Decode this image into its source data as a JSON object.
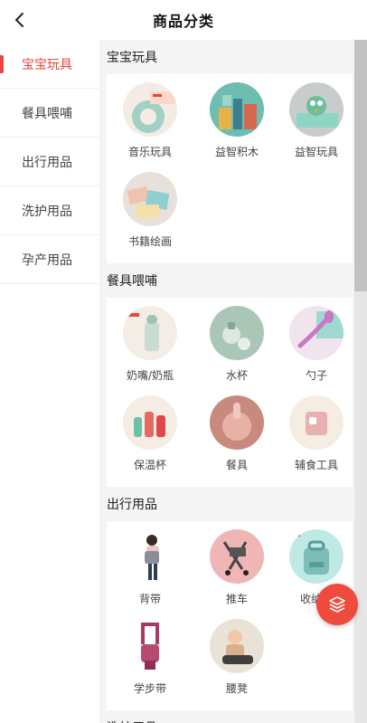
{
  "header": {
    "title": "商品分类",
    "back_icon": "chevron-left-icon"
  },
  "sidebar": {
    "active_index": 0,
    "items": [
      {
        "label": "宝宝玩具"
      },
      {
        "label": "餐具喂哺"
      },
      {
        "label": "出行用品"
      },
      {
        "label": "洗护用品"
      },
      {
        "label": "孕产用品"
      }
    ]
  },
  "sections": [
    {
      "title": "宝宝玩具",
      "items": [
        {
          "label": "音乐玩具"
        },
        {
          "label": "益智积木"
        },
        {
          "label": "益智玩具"
        },
        {
          "label": "书籍绘画"
        }
      ]
    },
    {
      "title": "餐具喂哺",
      "items": [
        {
          "label": "奶嘴/奶瓶"
        },
        {
          "label": "水杯"
        },
        {
          "label": "勺子"
        },
        {
          "label": "保温杯"
        },
        {
          "label": "餐具"
        },
        {
          "label": "辅食工具"
        }
      ]
    },
    {
      "title": "出行用品",
      "items": [
        {
          "label": "背带"
        },
        {
          "label": "推车"
        },
        {
          "label": "收纳包"
        },
        {
          "label": "学步带"
        },
        {
          "label": "腰凳"
        }
      ]
    },
    {
      "title": "洗护用品",
      "items": []
    }
  ],
  "fab": {
    "icon": "layers-icon"
  },
  "colors": {
    "accent": "#e8453c",
    "fab": "#ef4b3c",
    "panel_bg": "#f4f4f4"
  }
}
